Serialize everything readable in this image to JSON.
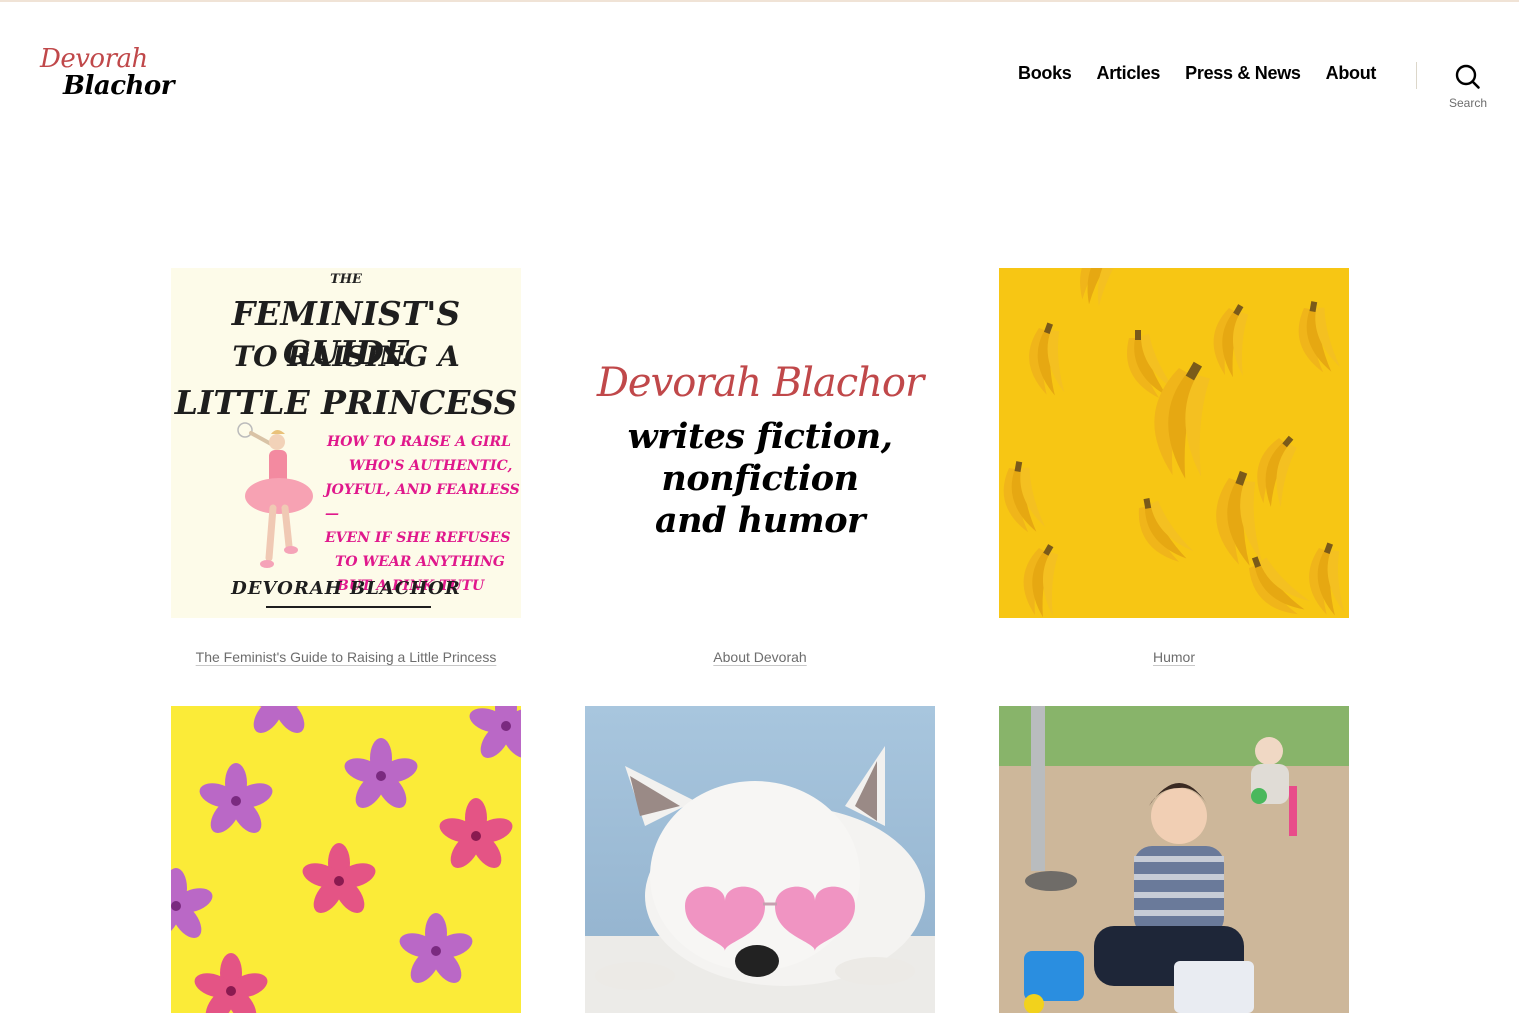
{
  "site": {
    "logo_line1": "Devorah",
    "logo_line2": "Blachor"
  },
  "nav": {
    "items": [
      "Books",
      "Articles",
      "Press & News",
      "About"
    ]
  },
  "search": {
    "label": "Search"
  },
  "tiles": [
    {
      "caption": "The Feminist's Guide to Raising a Little Princess",
      "cover": {
        "the": "THE",
        "title_lines": [
          "FEMINIST'S GUIDE",
          "TO RAISING A",
          "LITTLE PRINCESS"
        ],
        "subtitle_lines": [
          "HOW TO RAISE A GIRL",
          "WHO'S AUTHENTIC,",
          "JOYFUL, AND FEARLESS—",
          "EVEN IF SHE REFUSES",
          "TO WEAR ANYTHING",
          "BUT A PINK TUTU"
        ],
        "author": "DEVORAH BLACHOR"
      }
    },
    {
      "caption": "About Devorah",
      "headline": "Devorah Blachor",
      "tagline_lines": [
        "writes fiction,",
        "nonfiction",
        "and humor"
      ]
    },
    {
      "caption": "Humor"
    },
    {
      "caption": ""
    },
    {
      "caption": ""
    },
    {
      "caption": ""
    }
  ],
  "colors": {
    "brand_red": "#c0484a",
    "humor_yellow": "#f7c614",
    "flowers_yellow": "#fbeb38",
    "cover_pink": "#e0188c"
  }
}
